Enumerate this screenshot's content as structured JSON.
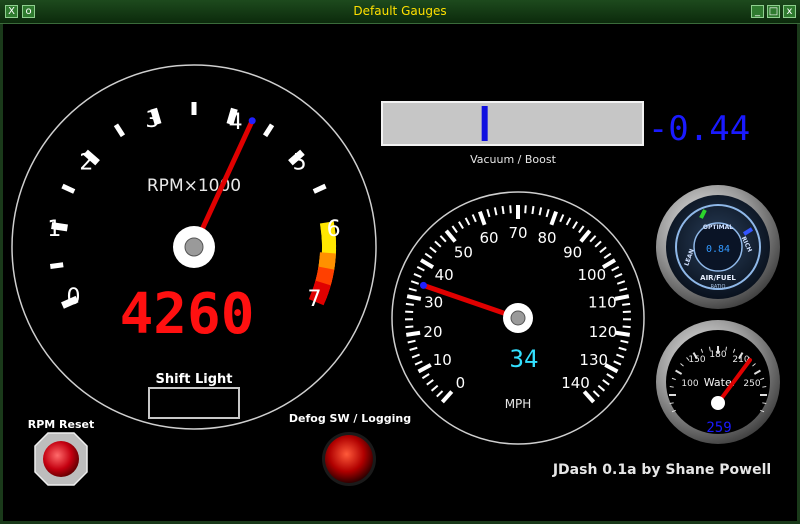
{
  "window": {
    "title": "Default Gauges",
    "close_glyph": "X",
    "menu_glyph": "o",
    "minimize_glyph": "_",
    "maximize_glyph": "□",
    "close_right_glyph": "x"
  },
  "tach": {
    "label": "RPM×1000",
    "ticks": [
      "0",
      "1",
      "2",
      "3",
      "4",
      "5",
      "6",
      "7"
    ],
    "value": 4.26,
    "readout": "4260"
  },
  "vacuum": {
    "label": "Vacuum / Boost",
    "readout": "-0.44",
    "marker_fraction": 0.39
  },
  "speedo": {
    "label": "MPH",
    "ticks": [
      "0",
      "10",
      "20",
      "30",
      "40",
      "50",
      "60",
      "70",
      "80",
      "90",
      "100",
      "110",
      "120",
      "130",
      "140"
    ],
    "value": 34,
    "readout": "34"
  },
  "airfuel": {
    "readout": "0.84",
    "top_label": "OPTIMAL",
    "left_label": "LEAN",
    "right_label": "RICH",
    "bottom_label": "AIR/FUEL",
    "sub_label": "RATIO"
  },
  "water": {
    "label": "Water",
    "ticks": [
      "100",
      "150",
      "180",
      "210",
      "250"
    ],
    "readout": "259"
  },
  "controls": {
    "shift_light_label": "Shift Light",
    "rpm_reset_label": "RPM Reset",
    "defog_label": "Defog SW / Logging"
  },
  "credit": "JDash 0.1a by Shane Powell",
  "colors": {
    "title_text": "#ffe000",
    "readout_red": "#ff1010",
    "readout_blue": "#1a1aff",
    "readout_cyan": "#33e0ff",
    "needle": "#e00000"
  }
}
